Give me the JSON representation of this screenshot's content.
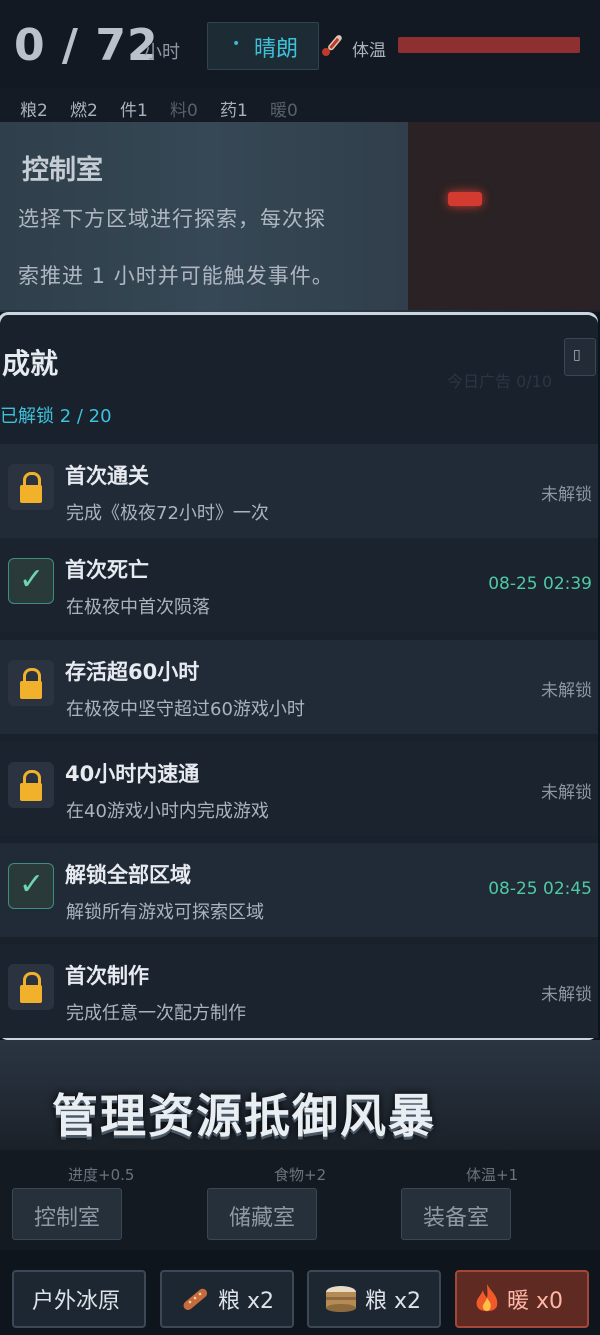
{
  "header": {
    "hours": "0 / 72",
    "hours_unit": "小时",
    "weather": "晴朗",
    "temp_label": "体温",
    "temp_level": 1.0,
    "resources": [
      "粮2",
      "燃2",
      "件1",
      "料0",
      "药1",
      "暖0"
    ]
  },
  "room": {
    "title": "控制室",
    "desc_line1": "选择下方区域进行探索，每次探",
    "desc_line2": "索推进 1 小时并可能触发事件。"
  },
  "achievements": {
    "title": "成就",
    "unlocked": "已解锁 2 / 20",
    "ghost_text": "今日广告 0/10",
    "items": [
      {
        "name": "首次通关",
        "desc": "完成《极夜72小时》一次",
        "state": "未解锁",
        "done": false
      },
      {
        "name": "首次死亡",
        "desc": "在极夜中首次陨落",
        "state": "08-25 02:39",
        "done": true
      },
      {
        "name": "存活超60小时",
        "desc": "在极夜中坚守超过60游戏小时",
        "state": "未解锁",
        "done": false
      },
      {
        "name": "40小时内速通",
        "desc": "在40游戏小时内完成游戏",
        "state": "未解锁",
        "done": false
      },
      {
        "name": "解锁全部区域",
        "desc": "解锁所有游戏可探索区域",
        "state": "08-25 02:45",
        "done": true
      },
      {
        "name": "首次制作",
        "desc": "完成任意一次配方制作",
        "state": "未解锁",
        "done": false
      }
    ]
  },
  "slogan": "管理资源抵御风暴",
  "rooms": [
    {
      "hint": "进度+0.5",
      "label": "控制室"
    },
    {
      "hint": "食物+2",
      "label": "储藏室"
    },
    {
      "hint": "体温+1",
      "label": "装备室"
    }
  ],
  "actions": {
    "outdoor": "户外冰原",
    "food1": "粮 x2",
    "food2": "粮 x2",
    "warm": "暖 x0"
  },
  "colors": {
    "accent": "#3ec0d9",
    "done": "#4fc9a3",
    "lock": "#f2b12b",
    "temp": "#8e3030"
  }
}
